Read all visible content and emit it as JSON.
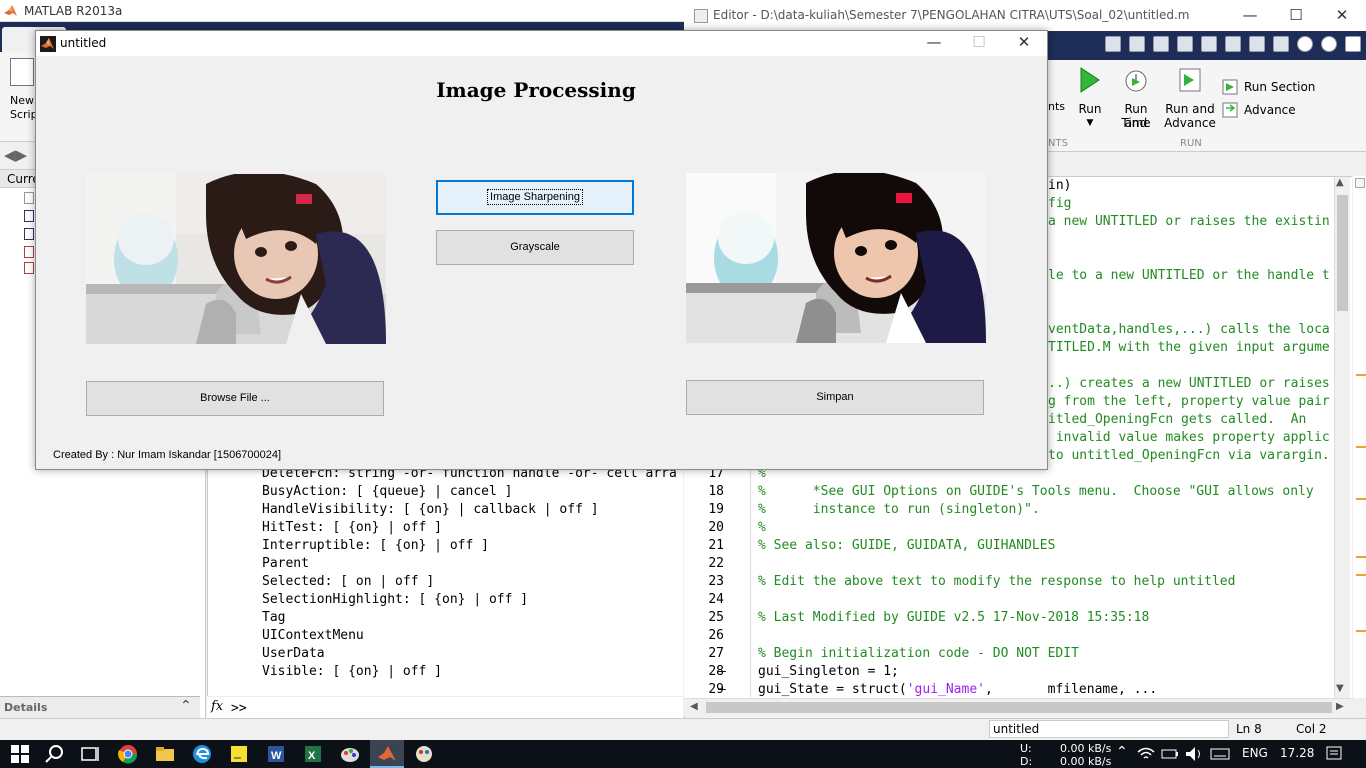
{
  "matlab_window": {
    "title": "MATLAB R2013a",
    "new_script_label_line1": "New",
    "new_script_label_line2": "Script",
    "current_folder_label": "Curre",
    "details_label": "Details",
    "prompt": ">>",
    "fx_label": "fx",
    "command_lines": [
      "DeleteFcn: string -or- function handle -or- cell arra",
      "BusyAction: [ {queue} | cancel ]",
      "HandleVisibility: [ {on} | callback | off ]",
      "HitTest: [ {on} | off ]",
      "Interruptible: [ {on} | off ]",
      "Parent",
      "Selected: [ on | off ]",
      "SelectionHighlight: [ {on} | off ]",
      "Tag",
      "UIContextMenu",
      "UserData",
      "Visible: [ {on} | off ]"
    ]
  },
  "editor": {
    "title": "Editor - D:\\data-kuliah\\Semester 7\\PENGOLAHAN CITRA\\UTS\\Soal_02\\untitled.m",
    "run_label": "Run",
    "run_and_time_line1": "Run and",
    "run_and_time_line2": "Time",
    "run_and_advance_line1": "Run and",
    "run_and_advance_line2": "Advance",
    "run_section_label": "Run Section",
    "advance_label": "Advance",
    "section_run": "RUN",
    "section_nts": "NTS",
    "nts_fragment": "nts",
    "right_fragments": [
      "in)",
      "fig",
      "a new UNTITLED or raises the existin",
      "",
      "",
      "le to a new UNTITLED or the handle t",
      "",
      "",
      "ventData,handles,...) calls the loca",
      "TITLED.M with the given input argume",
      "",
      "..) creates a new UNTITLED or raises",
      "g from the left, property value pair",
      "itled_OpeningFcn gets called.  An",
      " invalid value makes property applic",
      "to untitled_OpeningFcn via varargin."
    ],
    "line_numbers": [
      "17",
      "18",
      "19",
      "20",
      "21",
      "22",
      "23",
      "24",
      "25",
      "26",
      "27",
      "28",
      "29"
    ],
    "code_lines": [
      {
        "text": "%",
        "kind": "comment"
      },
      {
        "text": "%      *See GUI Options on GUIDE's Tools menu.  Choose \"GUI allows only",
        "kind": "comment"
      },
      {
        "text": "%      instance to run (singleton)\".",
        "kind": "comment"
      },
      {
        "text": "%",
        "kind": "comment"
      },
      {
        "text": "% See also: GUIDE, GUIDATA, GUIHANDLES",
        "kind": "comment"
      },
      {
        "text": "",
        "kind": "code"
      },
      {
        "text": "% Edit the above text to modify the response to help untitled",
        "kind": "comment"
      },
      {
        "text": "",
        "kind": "code"
      },
      {
        "text": "% Last Modified by GUIDE v2.5 17-Nov-2018 15:35:18",
        "kind": "comment"
      },
      {
        "text": "",
        "kind": "code"
      },
      {
        "text": "% Begin initialization code - DO NOT EDIT",
        "kind": "comment"
      },
      {
        "text": "gui_Singleton = 1;",
        "kind": "code"
      },
      {
        "text": "gui_State = struct(",
        "kind": "code",
        "str": "'gui_Name'",
        "rest": ",       mfilename, ..."
      }
    ],
    "status_file": "untitled",
    "status_ln": "Ln  8",
    "status_col": "Col  2"
  },
  "gui": {
    "window_title": "untitled",
    "heading": "Image Processing",
    "btn_sharpen": "Image Sharpening",
    "btn_grayscale": "Grayscale",
    "btn_browse": "Browse File ...",
    "btn_save": "Simpan",
    "credit": "Created By : Nur Imam Iskandar [1506700024]"
  },
  "taskbar": {
    "net_up_label": "U:",
    "net_down_label": "D:",
    "net_up": "0.00 kB/s",
    "net_down": "0.00 kB/s",
    "lang": "ENG",
    "time": "17.28"
  },
  "colors": {
    "matlab_blue": "#1e2d57",
    "comment_green": "#228b22",
    "string_purple": "#a020f0",
    "focus_blue": "#0078d7"
  }
}
